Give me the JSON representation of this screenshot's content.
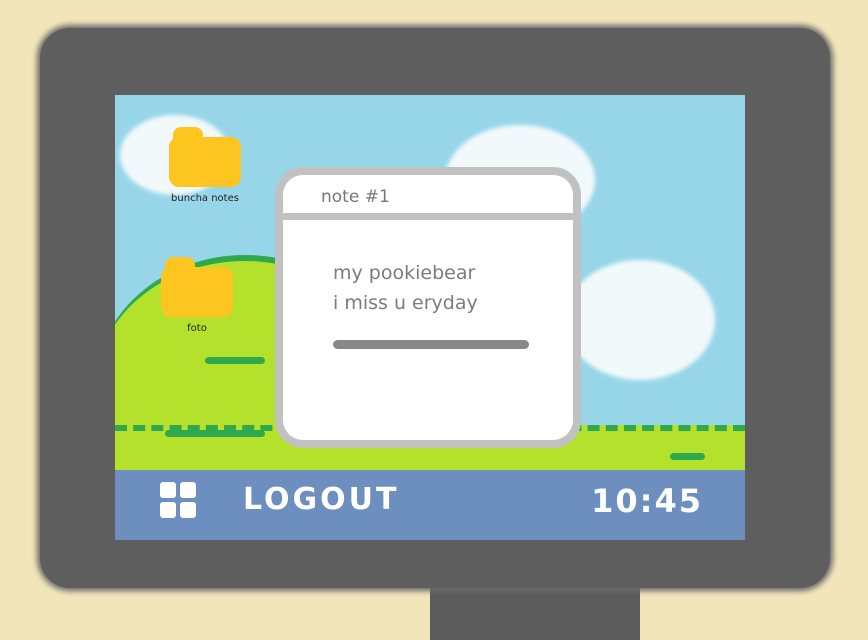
{
  "desktop": {
    "icons": [
      {
        "label": "buncha notes",
        "icon": "folder-icon"
      },
      {
        "label": "foto",
        "icon": "folder-icon"
      }
    ]
  },
  "note_window": {
    "title": "note #1",
    "lines": [
      "my pookiebear",
      "i miss u eryday"
    ]
  },
  "taskbar": {
    "start_icon": "grid-icon",
    "logout_label": "LOGOUT",
    "clock": "10:45"
  },
  "colors": {
    "sky": "#97d6e9",
    "grass": "#b3e12c",
    "taskbar": "#6c8fbf",
    "folder": "#fcc51f",
    "frame": "#5e5e5e"
  }
}
